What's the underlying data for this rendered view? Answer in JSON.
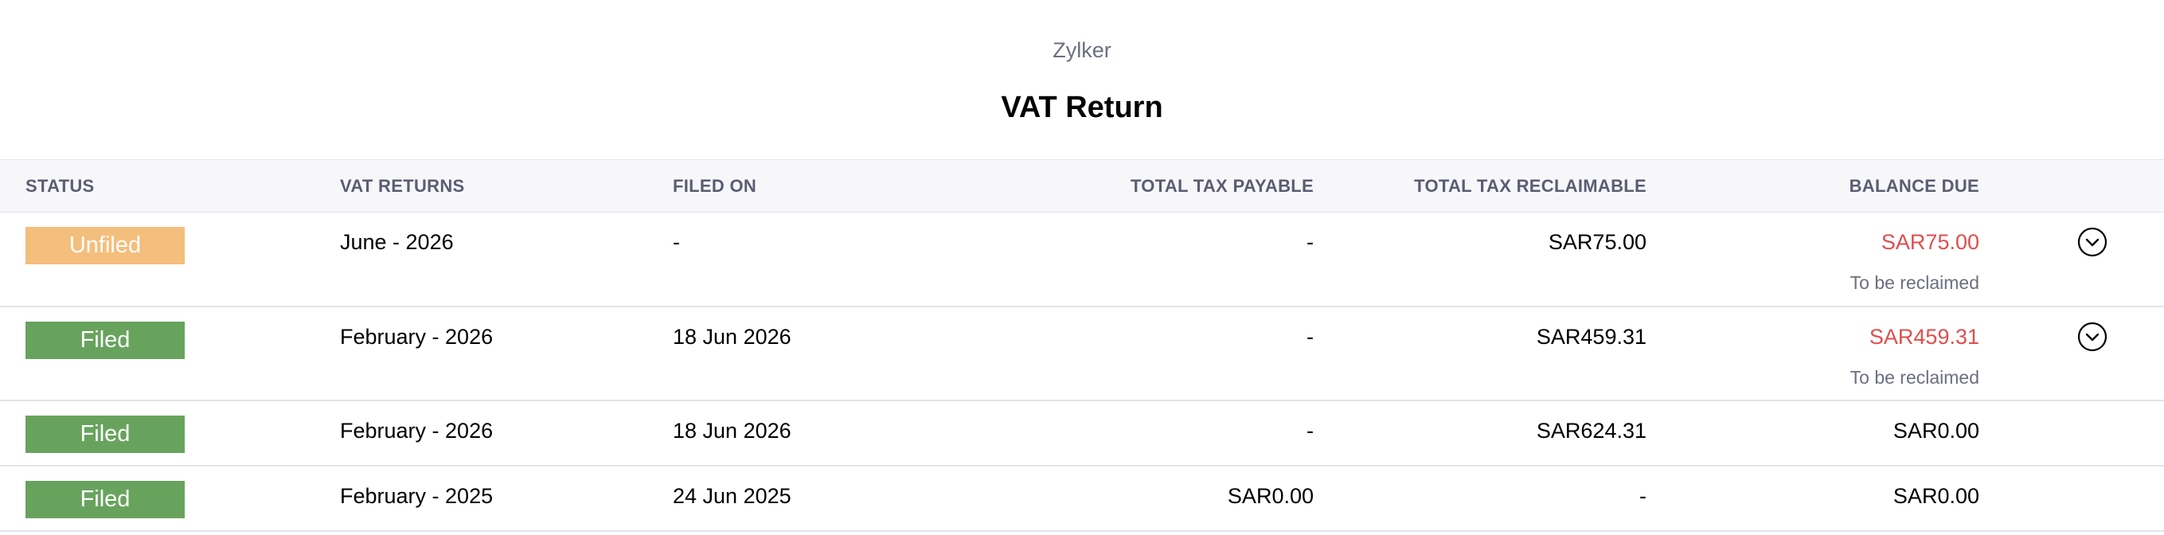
{
  "report": {
    "organization": "Zylker",
    "title": "VAT Return"
  },
  "columns": {
    "status": "STATUS",
    "vat_returns": "VAT RETURNS",
    "filed_on": "FILED ON",
    "total_tax_payable": "TOTAL TAX PAYABLE",
    "total_tax_reclaimable": "TOTAL TAX RECLAIMABLE",
    "balance_due": "BALANCE DUE"
  },
  "rows": [
    {
      "status": "Unfiled",
      "vat_return": "June - 2026",
      "filed_on": "-",
      "total_tax_payable": "-",
      "total_tax_reclaimable": "SAR75.00",
      "balance_due": "SAR75.00",
      "balance_note": "To be reclaimed",
      "action_icon": "chevron-down-circle-icon"
    },
    {
      "status": "Filed",
      "vat_return": "February - 2026",
      "filed_on": "18 Jun 2026",
      "total_tax_payable": "-",
      "total_tax_reclaimable": "SAR459.31",
      "balance_due": "SAR459.31",
      "balance_note": "To be reclaimed",
      "action_icon": "chevron-down-circle-icon"
    },
    {
      "status": "Filed",
      "vat_return": "February - 2026",
      "filed_on": "18 Jun 2026",
      "total_tax_payable": "-",
      "total_tax_reclaimable": "SAR624.31",
      "balance_due": "SAR0.00"
    },
    {
      "status": "Filed",
      "vat_return": "February - 2025",
      "filed_on": "24 Jun 2025",
      "total_tax_payable": "SAR0.00",
      "total_tax_reclaimable": "-",
      "balance_due": "SAR0.00"
    }
  ],
  "colors": {
    "unfiled_badge": "#f4be7c",
    "filed_badge": "#68a35e",
    "balance_due_red": "#e04e4e",
    "muted_text": "#6c6f80",
    "header_bg": "#f7f7fa"
  }
}
